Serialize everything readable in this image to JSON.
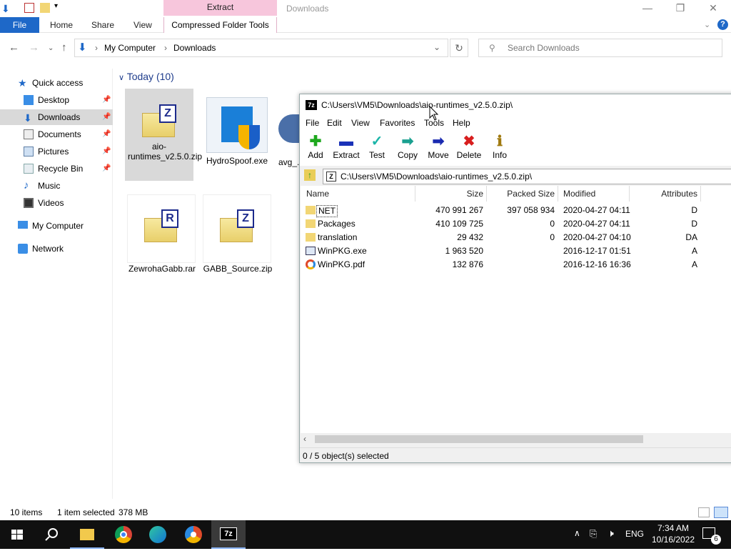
{
  "explorer": {
    "ribbon_context_tab": "Extract",
    "window_title": "Downloads",
    "tabs": {
      "file": "File",
      "home": "Home",
      "share": "Share",
      "view": "View",
      "compressed": "Compressed Folder Tools"
    },
    "breadcrumb": [
      "My Computer",
      "Downloads"
    ],
    "search_placeholder": "Search Downloads",
    "nav": [
      {
        "label": "Quick access"
      },
      {
        "label": "Desktop"
      },
      {
        "label": "Downloads"
      },
      {
        "label": "Documents"
      },
      {
        "label": "Pictures"
      },
      {
        "label": "Recycle Bin"
      },
      {
        "label": "Music"
      },
      {
        "label": "Videos"
      },
      {
        "label": "My Computer"
      },
      {
        "label": "Network"
      }
    ],
    "group_header": "Today (10)",
    "files": [
      {
        "name": "aio-runtimes_v2.5.0.zip",
        "badge": "Z"
      },
      {
        "name": "HydroSpoof.exe"
      },
      {
        "name": "avg_...ser_s"
      },
      {
        "name": "ZewrohaGabb.rar",
        "badge": "R"
      },
      {
        "name": "GABB_Source.zip",
        "badge": "Z"
      }
    ],
    "status": {
      "count": "10 items",
      "selected": "1 item selected",
      "size": "378 MB"
    }
  },
  "sevenzip": {
    "title": "C:\\Users\\VM5\\Downloads\\aio-runtimes_v2.5.0.zip\\",
    "menu": [
      "File",
      "Edit",
      "View",
      "Favorites",
      "Tools",
      "Help"
    ],
    "tools": [
      "Add",
      "Extract",
      "Test",
      "Copy",
      "Move",
      "Delete",
      "Info"
    ],
    "path": "C:\\Users\\VM5\\Downloads\\aio-runtimes_v2.5.0.zip\\",
    "columns": [
      "Name",
      "Size",
      "Packed Size",
      "Modified",
      "Attributes"
    ],
    "rows": [
      {
        "name": "NET",
        "size": "470 991 267",
        "packed": "397 058 934",
        "modified": "2020-04-27 04:11",
        "attr": "D"
      },
      {
        "name": "Packages",
        "size": "410 109 725",
        "packed": "0",
        "modified": "2020-04-27 04:11",
        "attr": "D"
      },
      {
        "name": "translation",
        "size": "29 432",
        "packed": "0",
        "modified": "2020-04-27 04:10",
        "attr": "DA"
      },
      {
        "name": "WinPKG.exe",
        "size": "1 963 520",
        "packed": "",
        "modified": "2016-12-17 01:51",
        "attr": "A"
      },
      {
        "name": "WinPKG.pdf",
        "size": "132 876",
        "packed": "",
        "modified": "2016-12-16 16:36",
        "attr": "A"
      }
    ],
    "status": "0 / 5 object(s) selected"
  },
  "taskbar": {
    "lang": "ENG",
    "time": "7:34 AM",
    "date": "10/16/2022",
    "notif_count": "6"
  }
}
